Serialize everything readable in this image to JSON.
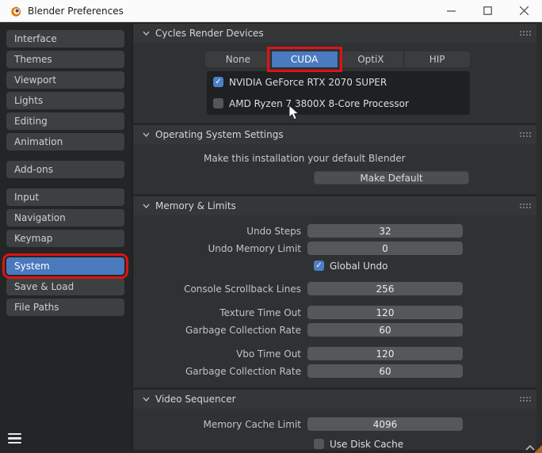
{
  "titlebar": {
    "title": "Blender Preferences"
  },
  "sidebar": {
    "group_a": [
      "Interface",
      "Themes",
      "Viewport",
      "Lights",
      "Editing",
      "Animation"
    ],
    "group_b": [
      "Add-ons"
    ],
    "group_c": [
      "Input",
      "Navigation",
      "Keymap"
    ],
    "group_d": [
      "System",
      "Save & Load",
      "File Paths"
    ],
    "active_item": "System"
  },
  "sections": {
    "cycles": {
      "title": "Cycles Render Devices",
      "tabs": [
        "None",
        "CUDA",
        "OptiX",
        "HIP"
      ],
      "selected_tab": "CUDA",
      "devices": [
        {
          "label": "NVIDIA GeForce RTX 2070 SUPER",
          "checked": true
        },
        {
          "label": "AMD Ryzen 7 3800X 8-Core Processor",
          "checked": false
        }
      ]
    },
    "os": {
      "title": "Operating System Settings",
      "description": "Make this installation your default Blender",
      "make_default_button": "Make Default"
    },
    "memory": {
      "title": "Memory & Limits",
      "rows": [
        {
          "label": "Undo Steps",
          "value": "32"
        },
        {
          "label": "Undo Memory Limit",
          "value": "0"
        },
        {
          "label": "Global Undo",
          "checked": true
        },
        {
          "label": "Console Scrollback Lines",
          "value": "256"
        },
        {
          "label": "Texture Time Out",
          "value": "120"
        },
        {
          "label": "Garbage Collection Rate",
          "value": "60"
        },
        {
          "label": "Vbo Time Out",
          "value": "120"
        },
        {
          "label": "Garbage Collection Rate",
          "value": "60"
        }
      ]
    },
    "video": {
      "title": "Video Sequencer",
      "memory_cache_label": "Memory Cache Limit",
      "memory_cache_value": "4096",
      "use_disk_cache_label": "Use Disk Cache",
      "use_disk_cache_checked": false
    }
  },
  "colors": {
    "accent_blue": "#4a7abf",
    "annotation_red": "#e01312",
    "titlebar_bg": "#fbfbfb",
    "panel_bg": "#2f3133"
  }
}
